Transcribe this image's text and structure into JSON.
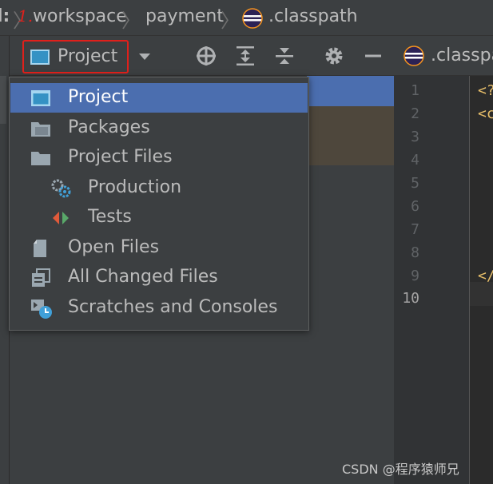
{
  "breadcrumb": {
    "partial": "l:",
    "annotation": "1.",
    "items": [
      "workspace",
      "payment",
      ".classpath"
    ]
  },
  "toolbar": {
    "view_label": "Project",
    "icons": [
      "dropdown-arrow-icon",
      "locate-icon",
      "expand-all-icon",
      "collapse-all-icon",
      "gear-icon",
      "minimize-icon"
    ]
  },
  "menu": {
    "items": [
      {
        "label": "Project",
        "icon": "project-view-icon",
        "selected": true
      },
      {
        "label": "Packages",
        "icon": "packages-folder-icon"
      },
      {
        "label": "Project Files",
        "icon": "folder-icon"
      },
      {
        "label": "Production",
        "icon": "production-gears-icon"
      },
      {
        "label": "Tests",
        "icon": "tests-icon"
      },
      {
        "label": "Open Files",
        "icon": "open-files-icon"
      },
      {
        "label": "All Changed Files",
        "icon": "changed-files-icon"
      },
      {
        "label": "Scratches and Consoles",
        "icon": "scratches-icon"
      }
    ]
  },
  "editor": {
    "tab_label": ".classpa",
    "line_numbers": [
      "1",
      "2",
      "3",
      "4",
      "5",
      "6",
      "7",
      "8",
      "9",
      "10"
    ],
    "current_line": "10",
    "code_fragments": {
      "l1": "<?",
      "l2": "<c",
      "l9": "</"
    }
  },
  "watermark": "CSDN @程序猿师兄",
  "colors": {
    "selection": "#4b6eaf",
    "annotation_red": "#e0201b",
    "panel_bg": "#3c3f41"
  }
}
